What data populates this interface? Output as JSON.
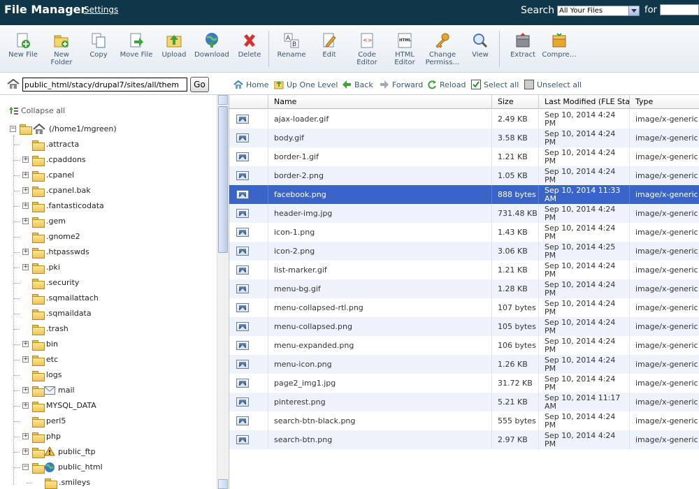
{
  "header": {
    "title": "File Manager",
    "settings_label": "Settings",
    "search_label": "Search",
    "search_scope": "All Your Files",
    "for_label": "for",
    "search_value": ""
  },
  "toolbar": {
    "new_file": "New File",
    "new_folder_1": "New",
    "new_folder_2": "Folder",
    "copy": "Copy",
    "move_file": "Move File",
    "upload": "Upload",
    "download": "Download",
    "delete": "Delete",
    "rename": "Rename",
    "edit": "Edit",
    "code_editor_1": "Code",
    "code_editor_2": "Editor",
    "html_editor_1": "HTML",
    "html_editor_2": "Editor",
    "change_perm_1": "Change",
    "change_perm_2": "Permiss…",
    "view": "View",
    "extract": "Extract",
    "compress": "Compre…"
  },
  "path": {
    "value": "public_html/stacy/drupal7/sites/all/them",
    "go_label": "Go"
  },
  "nav": {
    "home": "Home",
    "up_one_level": "Up One Level",
    "back": "Back",
    "forward": "Forward",
    "reload": "Reload",
    "select_all": "Select all",
    "unselect_all": "Unselect all"
  },
  "tree": {
    "collapse_all": "Collapse all",
    "root": "(/home1/mgreen)",
    "items": [
      {
        "label": ".attracta",
        "expandable": false
      },
      {
        "label": ".cpaddons",
        "expandable": true
      },
      {
        "label": ".cpanel",
        "expandable": true
      },
      {
        "label": ".cpanel.bak",
        "expandable": true
      },
      {
        "label": ".fantasticodata",
        "expandable": true
      },
      {
        "label": ".gem",
        "expandable": true
      },
      {
        "label": ".gnome2",
        "expandable": false
      },
      {
        "label": ".htpasswds",
        "expandable": true
      },
      {
        "label": ".pki",
        "expandable": true
      },
      {
        "label": ".security",
        "expandable": false
      },
      {
        "label": ".sqmailattach",
        "expandable": false
      },
      {
        "label": ".sqmaildata",
        "expandable": false
      },
      {
        "label": ".trash",
        "expandable": false
      },
      {
        "label": "bin",
        "expandable": true
      },
      {
        "label": "etc",
        "expandable": true
      },
      {
        "label": "logs",
        "expandable": false
      },
      {
        "label": "mail",
        "expandable": true
      },
      {
        "label": "MYSQL_DATA",
        "expandable": true
      },
      {
        "label": "perl5",
        "expandable": false
      },
      {
        "label": "php",
        "expandable": true
      },
      {
        "label": "public_ftp",
        "expandable": true
      },
      {
        "label": "public_html",
        "expandable": true
      },
      {
        "label": ".smileys",
        "expandable": false
      }
    ]
  },
  "table": {
    "columns": [
      "",
      "Name",
      "Size",
      "Last Modified (FLE Stand",
      "Type"
    ],
    "rows": [
      {
        "name": "ajax-loader.gif",
        "size": "2.49 KB",
        "modified": "Sep 10, 2014 4:24 PM",
        "type": "image/x-generic"
      },
      {
        "name": "body.gif",
        "size": "3.58 KB",
        "modified": "Sep 10, 2014 4:24 PM",
        "type": "image/x-generic"
      },
      {
        "name": "border-1.gif",
        "size": "1.21 KB",
        "modified": "Sep 10, 2014 4:24 PM",
        "type": "image/x-generic"
      },
      {
        "name": "border-2.png",
        "size": "1.05 KB",
        "modified": "Sep 10, 2014 4:24 PM",
        "type": "image/x-generic"
      },
      {
        "name": "facebook.png",
        "size": "888 bytes",
        "modified": "Sep 10, 2014 11:33 AM",
        "type": "image/x-generic",
        "selected": true
      },
      {
        "name": "header-img.jpg",
        "size": "731.48 KB",
        "modified": "Sep 10, 2014 4:24 PM",
        "type": "image/x-generic"
      },
      {
        "name": "icon-1.png",
        "size": "1.43 KB",
        "modified": "Sep 10, 2014 4:24 PM",
        "type": "image/x-generic"
      },
      {
        "name": "icon-2.png",
        "size": "3.06 KB",
        "modified": "Sep 10, 2014 4:25 PM",
        "type": "image/x-generic"
      },
      {
        "name": "list-marker.gif",
        "size": "1.21 KB",
        "modified": "Sep 10, 2014 4:24 PM",
        "type": "image/x-generic"
      },
      {
        "name": "menu-bg.gif",
        "size": "1.28 KB",
        "modified": "Sep 10, 2014 4:24 PM",
        "type": "image/x-generic"
      },
      {
        "name": "menu-collapsed-rtl.png",
        "size": "107 bytes",
        "modified": "Sep 10, 2014 4:24 PM",
        "type": "image/x-generic"
      },
      {
        "name": "menu-collapsed.png",
        "size": "105 bytes",
        "modified": "Sep 10, 2014 4:24 PM",
        "type": "image/x-generic"
      },
      {
        "name": "menu-expanded.png",
        "size": "106 bytes",
        "modified": "Sep 10, 2014 4:24 PM",
        "type": "image/x-generic"
      },
      {
        "name": "menu-icon.png",
        "size": "1.26 KB",
        "modified": "Sep 10, 2014 4:24 PM",
        "type": "image/x-generic"
      },
      {
        "name": "page2_img1.jpg",
        "size": "31.72 KB",
        "modified": "Sep 10, 2014 4:24 PM",
        "type": "image/x-generic"
      },
      {
        "name": "pinterest.png",
        "size": "5.21 KB",
        "modified": "Sep 10, 2014 11:17 AM",
        "type": "image/x-generic"
      },
      {
        "name": "search-btn-black.png",
        "size": "555 bytes",
        "modified": "Sep 10, 2014 4:24 PM",
        "type": "image/x-generic"
      },
      {
        "name": "search-btn.png",
        "size": "2.97 KB",
        "modified": "Sep 10, 2014 4:24 PM",
        "type": "image/x-generic"
      }
    ]
  },
  "colors": {
    "header_bg": "#0f3749",
    "selected_row": "#3a64c7",
    "alt_row": "#eef3fb"
  }
}
